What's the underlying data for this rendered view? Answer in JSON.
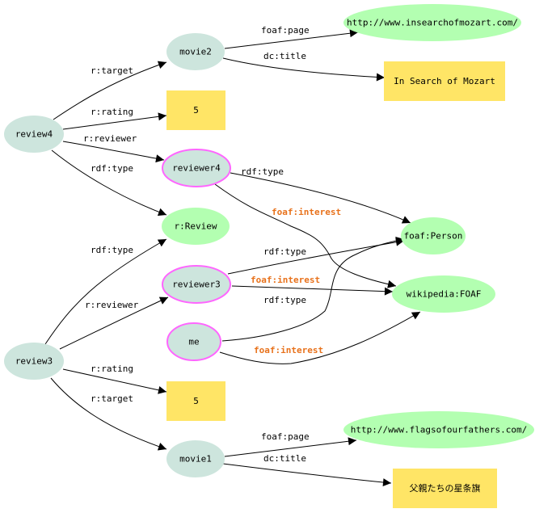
{
  "diagram": {
    "type": "rdf-graph",
    "colors": {
      "resource_fill": "#cde5dd",
      "class_fill": "#b3ffb1",
      "literal_fill": "#ffe566",
      "person_border": "#ff66ff",
      "edge": "#000000",
      "interest_label": "#e8721c"
    },
    "nodes": [
      {
        "id": "review4",
        "label": "review4",
        "kind": "resource"
      },
      {
        "id": "movie2",
        "label": "movie2",
        "kind": "resource"
      },
      {
        "id": "rating4",
        "label": "5",
        "kind": "literal"
      },
      {
        "id": "reviewer4",
        "label": "reviewer4",
        "kind": "person"
      },
      {
        "id": "rReview",
        "label": "r:Review",
        "kind": "class"
      },
      {
        "id": "url2",
        "label": "http://www.insearchofmozart.com/",
        "kind": "class"
      },
      {
        "id": "title2",
        "label": "In Search of Mozart",
        "kind": "literal"
      },
      {
        "id": "foafPerson",
        "label": "foaf:Person",
        "kind": "class"
      },
      {
        "id": "wikiFoaf",
        "label": "wikipedia:FOAF",
        "kind": "class"
      },
      {
        "id": "reviewer3",
        "label": "reviewer3",
        "kind": "person"
      },
      {
        "id": "me",
        "label": "me",
        "kind": "person"
      },
      {
        "id": "review3",
        "label": "review3",
        "kind": "resource"
      },
      {
        "id": "rating3",
        "label": "5",
        "kind": "literal"
      },
      {
        "id": "movie1",
        "label": "movie1",
        "kind": "resource"
      },
      {
        "id": "url1",
        "label": "http://www.flagsofourfathers.com/",
        "kind": "class"
      },
      {
        "id": "title1",
        "label": "父親たちの星条旗",
        "kind": "literal"
      }
    ],
    "edges": [
      {
        "from": "review4",
        "to": "movie2",
        "label": "r:target"
      },
      {
        "from": "review4",
        "to": "rating4",
        "label": "r:rating"
      },
      {
        "from": "review4",
        "to": "reviewer4",
        "label": "r:reviewer"
      },
      {
        "from": "review4",
        "to": "rReview",
        "label": "rdf:type"
      },
      {
        "from": "movie2",
        "to": "url2",
        "label": "foaf:page"
      },
      {
        "from": "movie2",
        "to": "title2",
        "label": "dc:title"
      },
      {
        "from": "reviewer4",
        "to": "foafPerson",
        "label": "rdf:type"
      },
      {
        "from": "reviewer4",
        "to": "wikiFoaf",
        "label": "foaf:interest",
        "highlight": true
      },
      {
        "from": "reviewer3",
        "to": "foafPerson",
        "label": "rdf:type"
      },
      {
        "from": "reviewer3",
        "to": "wikiFoaf",
        "label": "foaf:interest",
        "highlight": true
      },
      {
        "from": "me",
        "to": "foafPerson",
        "label": "rdf:type"
      },
      {
        "from": "me",
        "to": "wikiFoaf",
        "label": "foaf:interest",
        "highlight": true
      },
      {
        "from": "review3",
        "to": "rReview",
        "label": "rdf:type"
      },
      {
        "from": "review3",
        "to": "reviewer3",
        "label": "r:reviewer"
      },
      {
        "from": "review3",
        "to": "rating3",
        "label": "r:rating"
      },
      {
        "from": "review3",
        "to": "movie1",
        "label": "r:target"
      },
      {
        "from": "movie1",
        "to": "url1",
        "label": "foaf:page"
      },
      {
        "from": "movie1",
        "to": "title1",
        "label": "dc:title"
      }
    ]
  }
}
